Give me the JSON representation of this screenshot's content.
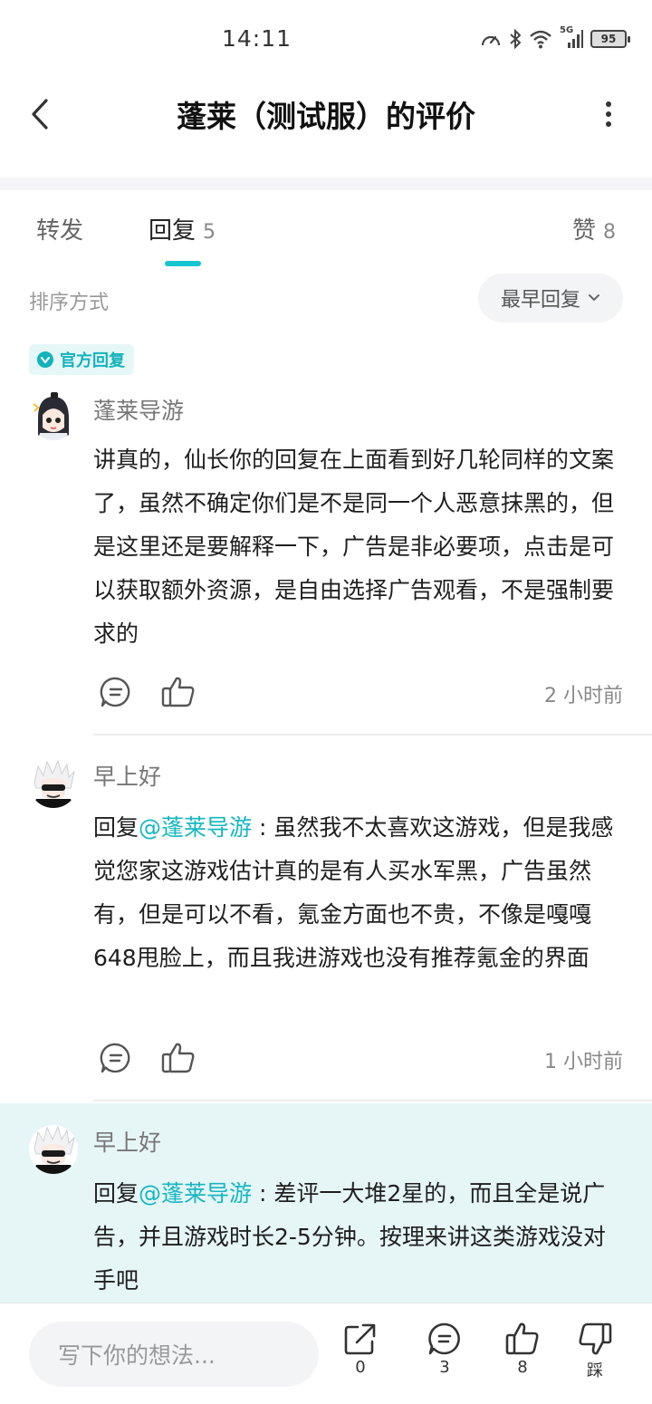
{
  "status": {
    "time": "14:11",
    "network": "5G",
    "battery": "95"
  },
  "header": {
    "title": "蓬莱（测试服）的评价"
  },
  "tabs": {
    "forward": {
      "label": "转发"
    },
    "reply": {
      "label": "回复",
      "count": "5"
    },
    "like": {
      "label": "赞",
      "count": "8"
    }
  },
  "sort": {
    "label": "排序方式",
    "selected": "最早回复"
  },
  "badge": {
    "official": "官方回复"
  },
  "comments": [
    {
      "author": "蓬莱导游",
      "text": "讲真的，仙长你的回复在上面看到好几轮同样的文案了，虽然不确定你们是不是同一个人恶意抹黑的，但是这里还是要解释一下，广告是非必要项，点击是可以获取额外资源，是自由选择广告观看，不是强制要求的",
      "time": "2 小时前"
    },
    {
      "author": "早上好",
      "reply_prefix": "回复",
      "mention": "@蓬莱导游",
      "text": " : 虽然我不太喜欢这游戏，但是我感觉您家这游戏估计真的是有人买水军黑，广告虽然有，但是可以不看，氪金方面也不贵，不像是嘎嘎648甩脸上，而且我进游戏也没有推荐氪金的界面",
      "time": "1 小时前"
    },
    {
      "author": "早上好",
      "reply_prefix": "回复",
      "mention": "@蓬莱导游",
      "text": " : 差评一大堆2星的，而且全是说广告，并且游戏时长2-5分钟。按理来讲这类游戏没对手吧"
    }
  ],
  "bottom_bar": {
    "input_placeholder": "写下你的想法...",
    "share_count": "0",
    "comment_count": "3",
    "like_count": "8",
    "dislike_label": "踩"
  },
  "colors": {
    "accent": "#15c5ce",
    "highlight": "#e6f6f7"
  }
}
